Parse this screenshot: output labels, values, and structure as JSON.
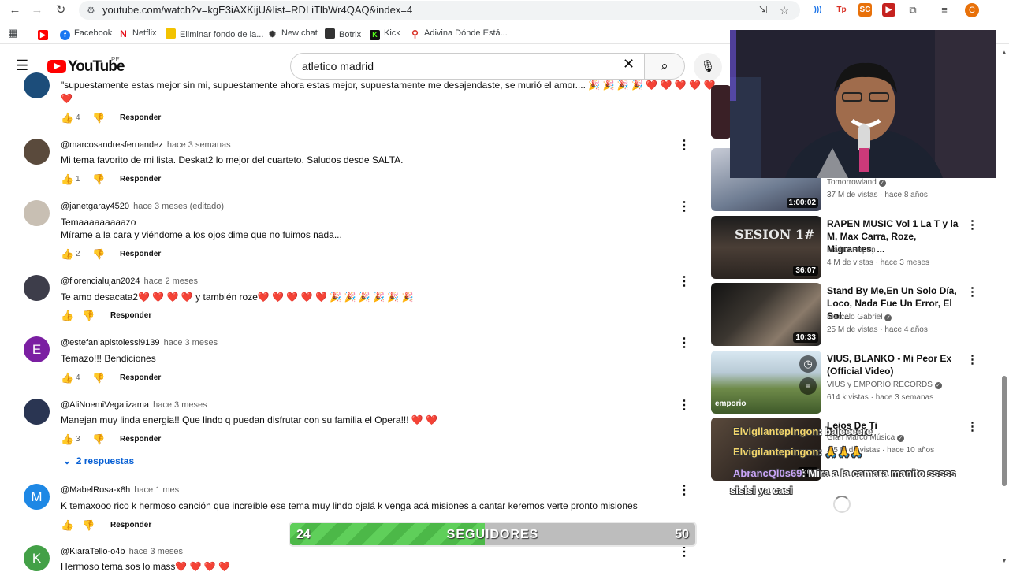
{
  "browser": {
    "url": "youtube.com/watch?v=kgE3iAXKijU&list=RDLiTlbWr4QAQ&index=4",
    "bookmarks": [
      "Facebook",
      "Netflix",
      "Eliminar fondo de la...",
      "New chat",
      "Botrix",
      "Kick",
      "Adivina Dónde Está..."
    ],
    "profile_initial": "C"
  },
  "youtube": {
    "logo_text": "YouTube",
    "country": "PE",
    "search_value": "atletico madrid"
  },
  "comments": [
    {
      "text": "\"supuestamente estas mejor sin mi, supuestamente ahora estas mejor, supuestamente me desajendaste, se murió el amor.... 🎉 🎉 🎉 🎉 ❤️ ❤️ ❤️ ❤️ ❤️",
      "text2": "❤️",
      "likes": "4",
      "reply": "Responder"
    },
    {
      "author": "@marcosandresfernandez",
      "time": "hace 3 semanas",
      "text": "Mi tema favorito de mi lista. Deskat2 lo mejor del cuarteto. Saludos desde SALTA.",
      "likes": "1",
      "reply": "Responder"
    },
    {
      "author": "@janetgaray4520",
      "time": "hace 3 meses (editado)",
      "text": "Temaaaaaaaaazo",
      "text2": "Mírame a la cara y viéndome a los ojos dime que no fuimos nada...",
      "likes": "2",
      "reply": "Responder"
    },
    {
      "author": "@florencialujan2024",
      "time": "hace 2 meses",
      "text": "Te amo desacata2❤️ ❤️ ❤️ ❤️  y también roze❤️ ❤️ ❤️ ❤️ ❤️ 🎉 🎉 🎉 🎉 🎉 🎉",
      "likes": "",
      "reply": "Responder"
    },
    {
      "author": "@estefaniapistolessi9139",
      "time": "hace 3 meses",
      "text": "Temazo!!! Bendiciones",
      "likes": "4",
      "reply": "Responder",
      "avatar": "E"
    },
    {
      "author": "@AliNoemiVegalizama",
      "time": "hace 3 meses",
      "text": "Manejan muy linda energia!! Que lindo q puedan disfrutar con su familia el Opera!!! ❤️ ❤️",
      "likes": "3",
      "reply": "Responder"
    },
    {
      "author": "@MabelRosa-x8h",
      "time": "hace 1 mes",
      "text": "K temaxooo  rico k hermoso canción que increíble ese tema muy lindo ojalá k venga acá misiones a cantar keremos  verte pronto misiones",
      "likes": "",
      "reply": "Responder",
      "avatar": "M"
    },
    {
      "author": "@KiaraTello-o4b",
      "time": "hace 3 meses",
      "text": "Hermoso tema sos lo mass❤️ ❤️ ❤️ ❤️",
      "avatar": "K"
    }
  ],
  "replies_link": "2 respuestas",
  "sidebar": [
    {
      "title": "",
      "channel": "Tomorrowland",
      "stats": "37 M de vistas · hace 8 años",
      "duration": "1:00:02"
    },
    {
      "title": "RAPEN MUSIC Vol 1 La T y la M, Max Carra, Roze, Migrantes, ...",
      "channel": "Matias Rapen",
      "stats": "4 M de vistas · hace 3 meses",
      "duration": "36:07",
      "thumb_text": "SESION 1#"
    },
    {
      "title": "Stand By Me,En Un Solo Día, Loco, Nada Fue Un Error, El Sol...",
      "channel": "Marcelo Gabriel",
      "stats": "25 M de vistas · hace 4 años",
      "duration": "10:33"
    },
    {
      "title": "VIUS, BLANKO -  Mi Peor Ex (Official Video)",
      "channel": "VIUS  y EMPORIO RECORDS",
      "stats": "614 k vistas · hace 3 semanas",
      "duration": "",
      "thumb_text": "emporio"
    },
    {
      "title": "Lejos De Ti",
      "channel": "Gian Marco Música",
      "stats": "2.5 M de vistas · hace 10 años",
      "duration": "4:04"
    }
  ],
  "stream_chat": [
    {
      "user": "Elvigilantepingon",
      "msg": ": bajeeeere"
    },
    {
      "user": "Elvigilantepingon",
      "msg": ": 🙏🙏🙏"
    },
    {
      "user": "AbrancQl0s69",
      "msg": ": Mira a la camara manito sssss"
    },
    {
      "user": "",
      "msg": "sisisi ya casi"
    }
  ],
  "followers": {
    "current": "24",
    "label": "SEGUIDORES",
    "goal": "50",
    "progress": 0.48
  },
  "colors": {
    "yt_red": "#ff0000",
    "link_blue": "#065fd4",
    "follow_green": "#5fcf5a",
    "chat_user": "#f3d56b",
    "chat_user2": "#c9a4f5"
  }
}
